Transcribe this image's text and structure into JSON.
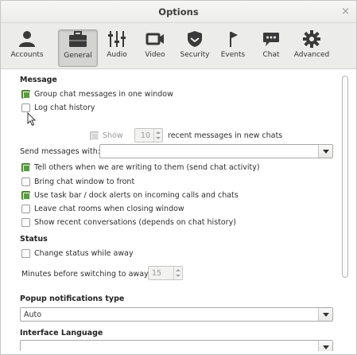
{
  "window": {
    "title": "Options",
    "close_glyph": "×"
  },
  "toolbar": {
    "items": [
      {
        "label": "Accounts",
        "icon": "accounts-icon",
        "active": false
      },
      {
        "label": "General",
        "icon": "general-icon",
        "active": true
      },
      {
        "label": "Audio",
        "icon": "audio-icon",
        "active": false
      },
      {
        "label": "Video",
        "icon": "video-icon",
        "active": false
      },
      {
        "label": "Security",
        "icon": "security-icon",
        "active": false
      },
      {
        "label": "Events",
        "icon": "events-icon",
        "active": false
      },
      {
        "label": "Chat",
        "icon": "chat-icon",
        "active": false
      },
      {
        "label": "Advanced",
        "icon": "advanced-icon",
        "active": false
      }
    ]
  },
  "message": {
    "heading": "Message",
    "group_chat": {
      "label": "Group chat messages in one window",
      "checked": true
    },
    "log_history": {
      "label": "Log chat history",
      "checked": false
    },
    "show": {
      "label": "Show",
      "checked": true,
      "disabled": true
    },
    "show_count": "10",
    "show_suffix": "recent messages in new chats",
    "send_with_label": "Send messages with:",
    "send_with_value": "",
    "options": [
      {
        "label": "Tell others when we are writing to them (send chat activity)",
        "checked": true
      },
      {
        "label": "Bring chat window to front",
        "checked": false
      },
      {
        "label": "Use task bar / dock alerts on incoming calls and chats",
        "checked": true
      },
      {
        "label": "Leave chat rooms when closing window",
        "checked": false
      },
      {
        "label": "Show recent conversations (depends on chat history)",
        "checked": false
      }
    ]
  },
  "status": {
    "heading": "Status",
    "change_away": {
      "label": "Change status while away",
      "checked": false
    },
    "minutes_label": "Minutes before switching to away:",
    "minutes_value": "15"
  },
  "popup": {
    "heading": "Popup notifications type",
    "value": "Auto"
  },
  "language": {
    "heading": "Interface Language",
    "value": ""
  },
  "colors": {
    "checkbox_on": "#5a9c3f",
    "toolbar_bg": "#ececea",
    "active_tab": "#d3d3d1"
  }
}
